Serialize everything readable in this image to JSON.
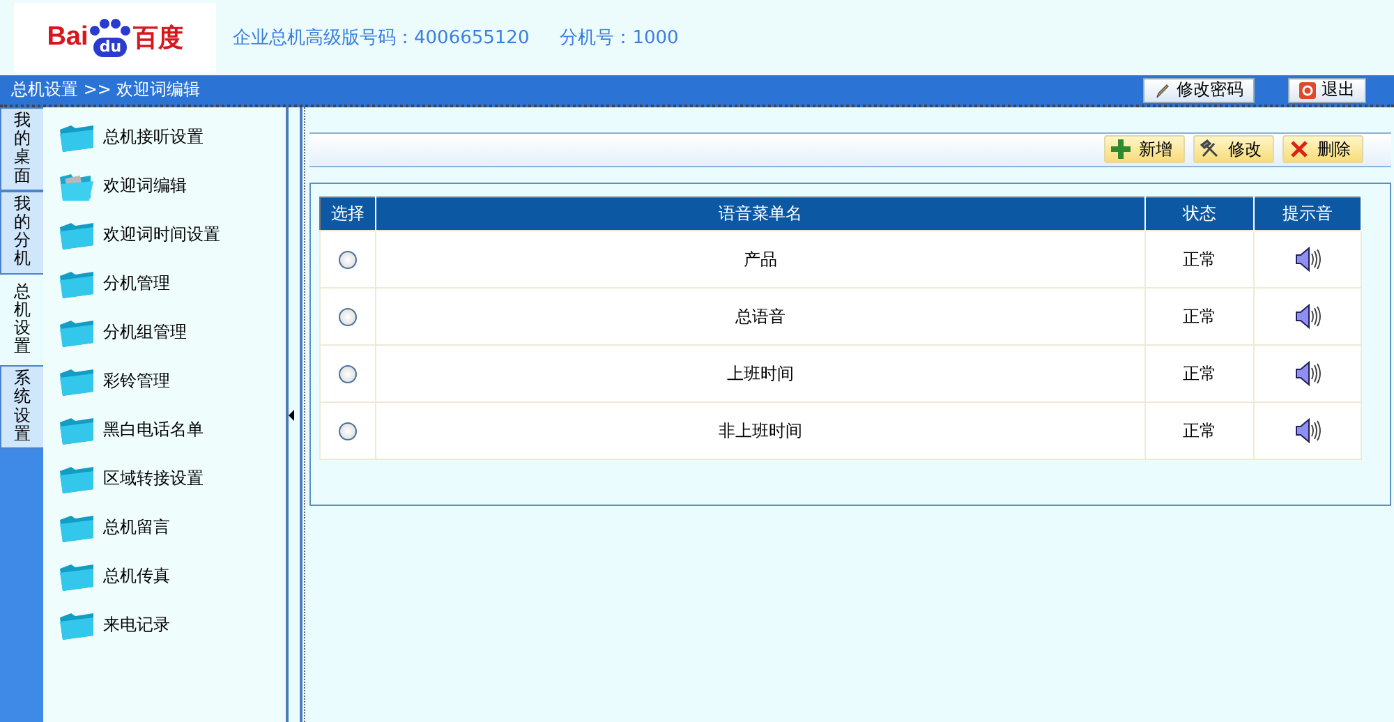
{
  "header": {
    "logo": {
      "latin": "Bai",
      "paw": "du",
      "chinese": "百度"
    },
    "info": "企业总机高级版号码：4006655120",
    "extension": "分机号：1000"
  },
  "breadcrumb": "总机设置 >> 欢迎词编辑",
  "top_buttons": [
    {
      "label": "修改密码",
      "kind": "pencil"
    },
    {
      "label": "退出",
      "kind": "exit"
    }
  ],
  "side_tabs": [
    {
      "label": "我的桌面",
      "selected": false
    },
    {
      "label": "我的分机",
      "selected": false
    },
    {
      "label": "总机设置",
      "selected": true
    },
    {
      "label": "系统设置",
      "selected": false
    }
  ],
  "sidebar": {
    "items": [
      {
        "label": "总机接听设置",
        "selected": false
      },
      {
        "label": "欢迎词编辑",
        "selected": true
      },
      {
        "label": "欢迎词时间设置",
        "selected": false
      },
      {
        "label": "分机管理",
        "selected": false
      },
      {
        "label": "分机组管理",
        "selected": false
      },
      {
        "label": "彩铃管理",
        "selected": false
      },
      {
        "label": "黑白电话名单",
        "selected": false
      },
      {
        "label": "区域转接设置",
        "selected": false
      },
      {
        "label": "总机留言",
        "selected": false
      },
      {
        "label": "总机传真",
        "selected": false
      },
      {
        "label": "来电记录",
        "selected": false
      }
    ]
  },
  "toolbar": [
    {
      "label": "新增",
      "kind": "add"
    },
    {
      "label": "修改",
      "kind": "edit"
    },
    {
      "label": "删除",
      "kind": "delete"
    }
  ],
  "table": {
    "columns": [
      "选择",
      "语音菜单名",
      "状态",
      "提示音"
    ],
    "rows": [
      {
        "selected": false,
        "name": "产品",
        "status": "正常"
      },
      {
        "selected": false,
        "name": "总语音",
        "status": "正常"
      },
      {
        "selected": false,
        "name": "上班时间",
        "status": "正常"
      },
      {
        "selected": false,
        "name": "非上班时间",
        "status": "正常"
      }
    ]
  }
}
